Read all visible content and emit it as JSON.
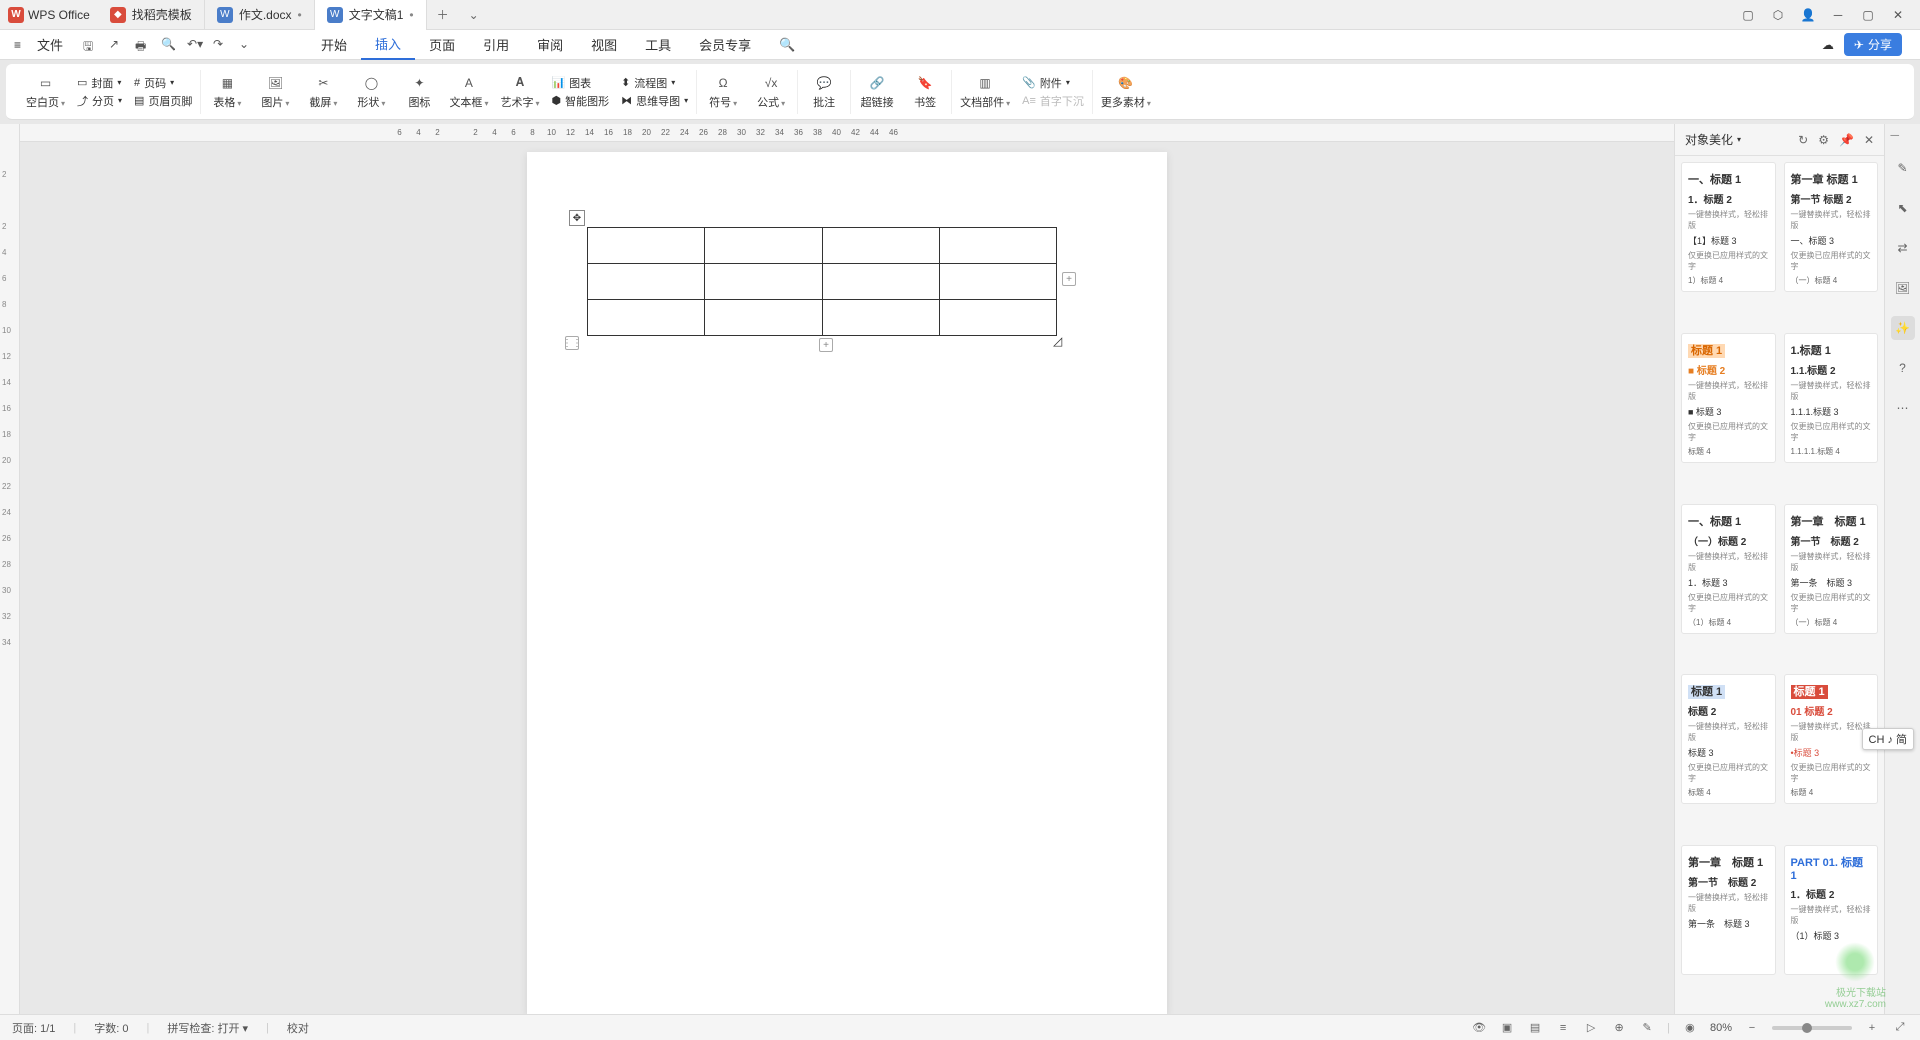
{
  "app": {
    "name": "WPS Office"
  },
  "tabs": [
    {
      "label": "找稻壳模板",
      "icon": "red"
    },
    {
      "label": "作文.docx",
      "icon": "blue"
    },
    {
      "label": "文字文稿1",
      "icon": "blue",
      "active": true
    }
  ],
  "file_menu": "文件",
  "menu_tabs": [
    "开始",
    "插入",
    "页面",
    "引用",
    "审阅",
    "视图",
    "工具",
    "会员专享"
  ],
  "menu_active": "插入",
  "ribbon": {
    "blank_page": "空白页",
    "cover": "封面",
    "page_num": "页码",
    "page_break": "分页",
    "header_footer": "页眉页脚",
    "table": "表格",
    "picture": "图片",
    "screenshot": "截屏",
    "shape": "形状",
    "icon": "图标",
    "textbox": "文本框",
    "wordart": "艺术字",
    "chart": "图表",
    "flowchart": "流程图",
    "smartart": "智能图形",
    "mindmap": "思维导图",
    "symbol": "符号",
    "equation": "公式",
    "comment": "批注",
    "hyperlink": "超链接",
    "bookmark": "书签",
    "docparts": "文档部件",
    "attachment": "附件",
    "dropcap": "首字下沉",
    "more": "更多素材"
  },
  "hruler_ticks": [
    "6",
    "4",
    "2",
    "",
    "2",
    "4",
    "6",
    "8",
    "10",
    "12",
    "14",
    "16",
    "18",
    "20",
    "22",
    "24",
    "26",
    "28",
    "30",
    "32",
    "34",
    "36",
    "38",
    "40",
    "42",
    "44",
    "46"
  ],
  "vruler_ticks": [
    "",
    "2",
    "",
    "2",
    "4",
    "6",
    "8",
    "10",
    "12",
    "14",
    "16",
    "18",
    "20",
    "22",
    "24",
    "26",
    "28",
    "30",
    "32",
    "34"
  ],
  "sidepanel": {
    "title": "对象美化",
    "cards": [
      {
        "l1": "一、标题 1",
        "l2": "1．标题 2",
        "desc": "一键替换样式，轻松排版",
        "l3": "【1】标题 3",
        "d2": "仅更换已应用样式的文字",
        "l4": "1）标题 4"
      },
      {
        "l1": "第一章 标题 1",
        "l2": "第一节 标题 2",
        "desc": "一键替换样式，轻松排版",
        "l3": "一、标题 3",
        "d2": "仅更换已应用样式的文字",
        "l4": "（一）标题 4"
      },
      {
        "l1": "标题 1",
        "l1_hl": "orange",
        "l2": "■ 标题 2",
        "l2_cls": "txt-orange",
        "desc": "一键替换样式，轻松排版",
        "l3": "■ 标题 3",
        "d2": "仅更换已应用样式的文字",
        "l4": "标题 4"
      },
      {
        "l1": "1.标题 1",
        "l2": "1.1.标题 2",
        "desc": "一键替换样式，轻松排版",
        "l3": "1.1.1.标题 3",
        "d2": "仅更换已应用样式的文字",
        "l4": "1.1.1.1.标题 4"
      },
      {
        "l1": "一、标题 1",
        "l2": "（一）标题 2",
        "desc": "一键替换样式，轻松排版",
        "l3": "1．标题 3",
        "d2": "仅更换已应用样式的文字",
        "l4": "（1）标题 4"
      },
      {
        "l1": "第一章　标题 1",
        "l2": "第一节　标题 2",
        "desc": "一键替换样式，轻松排版",
        "l3": "第一条　标题 3",
        "d2": "仅更换已应用样式的文字",
        "l4": "（一）标题 4"
      },
      {
        "l1": "标题 1",
        "l1_hl": "blue",
        "l2": "标题 2",
        "desc": "一键替换样式，轻松排版",
        "l3": "标题 3",
        "d2": "仅更换已应用样式的文字",
        "l4": "标题 4"
      },
      {
        "l1": "标题 1",
        "l1_hl": "red",
        "l2": "01 标题 2",
        "l2_cls": "txt-red",
        "desc": "一键替换样式，轻松排版",
        "l3": "•标题 3",
        "l3_cls": "txt-red",
        "d2": "仅更换已应用样式的文字",
        "l4": "标题 4"
      },
      {
        "l1": "第一章　标题 1",
        "l2": "第一节　标题 2",
        "desc": "一键替换样式，轻松排版",
        "l3": "第一条　标题 3"
      },
      {
        "l1": "PART 01. 标题 1",
        "l1_cls": "txt-blue",
        "l2": "1．标题 2",
        "desc": "一键替换样式，轻松排版",
        "l3": "（1）标题 3"
      }
    ]
  },
  "status": {
    "page": "页面: 1/1",
    "words": "字数: 0",
    "spellcheck": "拼写检查: 打开",
    "proofread": "校对",
    "zoom": "80%"
  },
  "share": "分享",
  "ime": "CH ♪ 简",
  "watermark": {
    "l1": "极光下载站",
    "l2": "www.xz7.com"
  }
}
